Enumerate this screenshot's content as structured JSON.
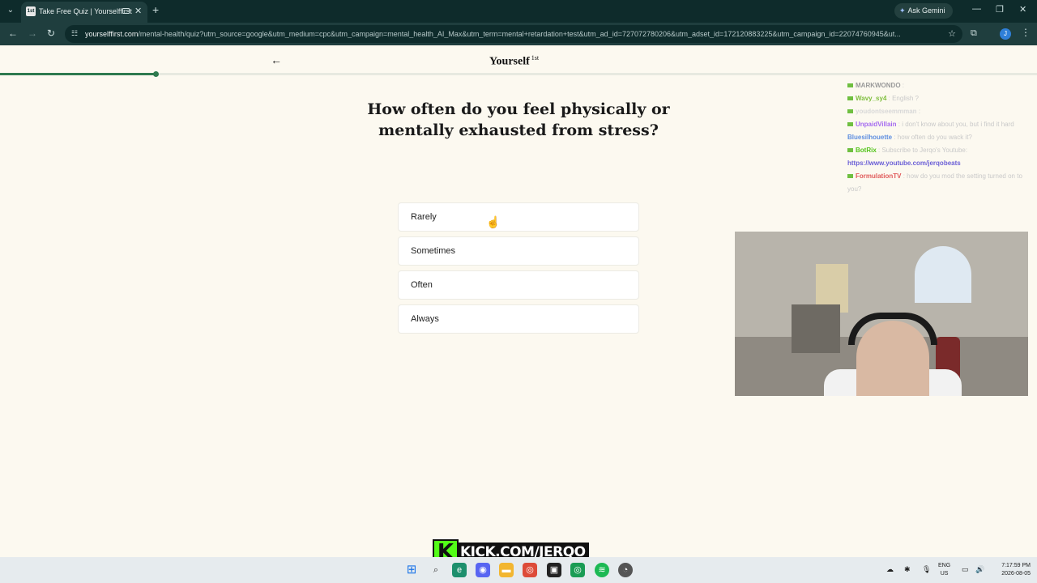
{
  "browser": {
    "tab_title": "Take Free Quiz | Yourselffirst",
    "tab_favicon": "1st",
    "gemini_label": "Ask Gemini",
    "url_host": "yourselffirst.com",
    "url_rest": "/mental-health/quiz?utm_source=google&utm_medium=cpc&utm_campaign=mental_health_AI_Max&utm_term=mental+retardation+test&utm_ad_id=727072780206&utm_adset_id=172120883225&utm_campaign_id=22074760945&ut...",
    "profile_initial": "J"
  },
  "page": {
    "logo": "Yourself",
    "logo_sup": "1st",
    "progress_fraction": 0.15,
    "question": "How often do you feel physically or mentally exhausted from stress?",
    "options": [
      {
        "label": "Rarely"
      },
      {
        "label": "Sometimes"
      },
      {
        "label": "Often"
      },
      {
        "label": "Always"
      }
    ]
  },
  "chat": {
    "messages": [
      {
        "name": "MARKWONDO",
        "name_color": "#9a9a9a",
        "text": ":"
      },
      {
        "name": "Wavy_sy4",
        "name_color": "#7fbf3f",
        "text": ": English ?"
      },
      {
        "name": "youdontseemmman",
        "name_color": "#d8d8d8",
        "text": ":"
      },
      {
        "name": "UnpaidVillain",
        "name_color": "#a56bf0",
        "text": ": i don't know about you, but i find it hard"
      },
      {
        "name": "Bluesilhouette",
        "name_color": "#5f8fe0",
        "text": ": how often do you wack it?"
      },
      {
        "name": "BotRix",
        "name_color": "#53c41a",
        "text": ": Subscribe to Jerqo's Youtube:"
      },
      {
        "name": "",
        "name_color": "#6b5fd6",
        "text": "https://www.youtube.com/jerqobeats"
      },
      {
        "name": "FormulationTV",
        "name_color": "#e05a5a",
        "text": ": how do you mod the setting turned on to"
      },
      {
        "name": "",
        "name_color": "#c9c9c9",
        "text": "you?"
      }
    ]
  },
  "stream": {
    "kick_logo": "K",
    "kick_text": "KICK.COM/JERQO"
  },
  "taskbar": {
    "lang_top": "ENG",
    "lang_bottom": "US",
    "time": "7:17:59 PM",
    "date": "2026-08-05"
  }
}
